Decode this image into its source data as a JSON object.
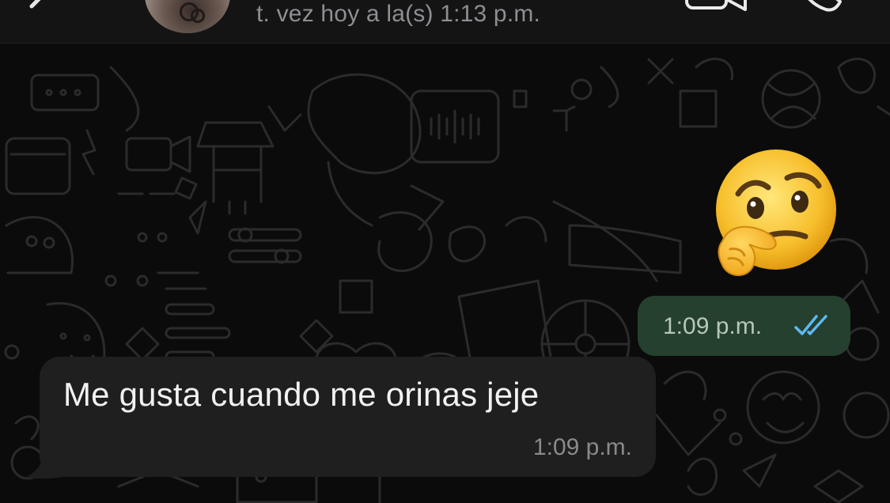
{
  "header": {
    "last_seen": "t. vez hoy a la(s) 1:13 p.m.",
    "back_icon": "chevron-left-icon",
    "video_icon": "video-camera-icon",
    "phone_icon": "phone-icon"
  },
  "messages": [
    {
      "direction": "outgoing",
      "type": "emoji",
      "emoji": "🤔"
    },
    {
      "direction": "outgoing",
      "type": "status",
      "time": "1:09 p.m.",
      "read_status": "read-double-check"
    },
    {
      "direction": "incoming",
      "type": "text",
      "text": "Me gusta cuando me orinas jeje",
      "time": "1:09 p.m."
    }
  ],
  "colors": {
    "background": "#0b0b0b",
    "header": "#141414",
    "outgoing_bubble": "#25402e",
    "incoming_bubble": "#1f1f1f",
    "read_ticks": "#5fb8f0"
  }
}
